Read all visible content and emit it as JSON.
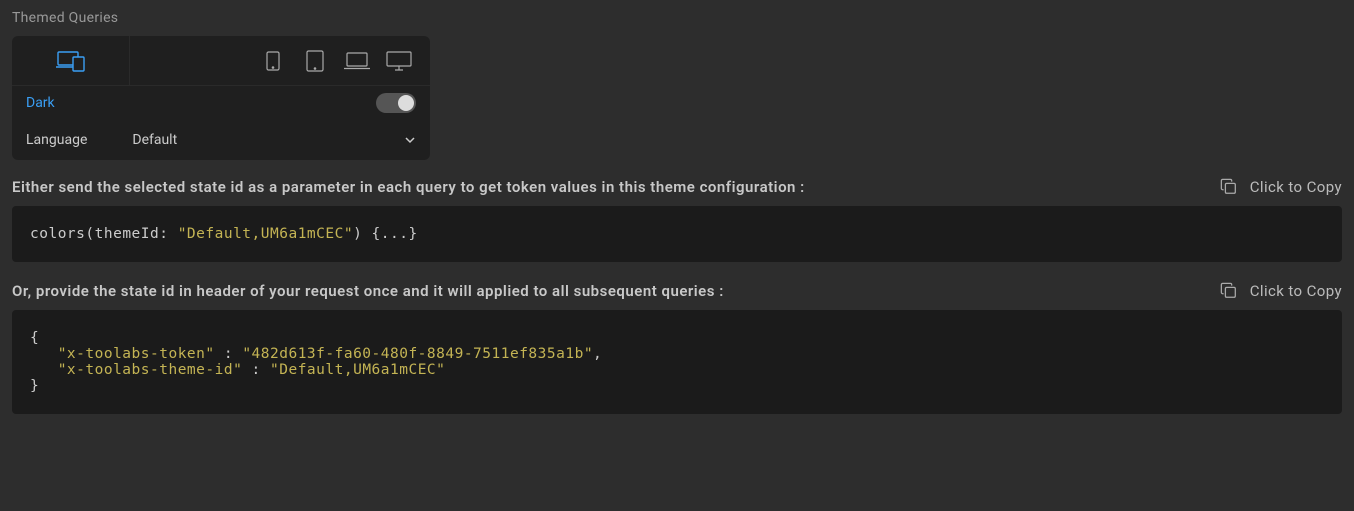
{
  "title": "Themed Queries",
  "config": {
    "dark_label": "Dark",
    "language_label": "Language",
    "language_value": "Default"
  },
  "desc1": "Either send the selected state id as a parameter in each query to get token values in this theme configuration :",
  "desc2": "Or, provide the state id in header of your request once and it will applied to all subsequent queries :",
  "copy_label": "Click to Copy",
  "code1": {
    "fn": "colors",
    "param": "themeId",
    "value": "\"Default,UM6a1mCEC\"",
    "rest": " {...}"
  },
  "code2": {
    "open": "{",
    "k1": "\"x-toolabs-token\"",
    "colon": " : ",
    "v1": "\"482d613f-fa60-480f-8849-7511ef835a1b\"",
    "comma": ",",
    "k2": "\"x-toolabs-theme-id\"",
    "v2": "\"Default,UM6a1mCEC\"",
    "close": "}",
    "indent": "   "
  }
}
